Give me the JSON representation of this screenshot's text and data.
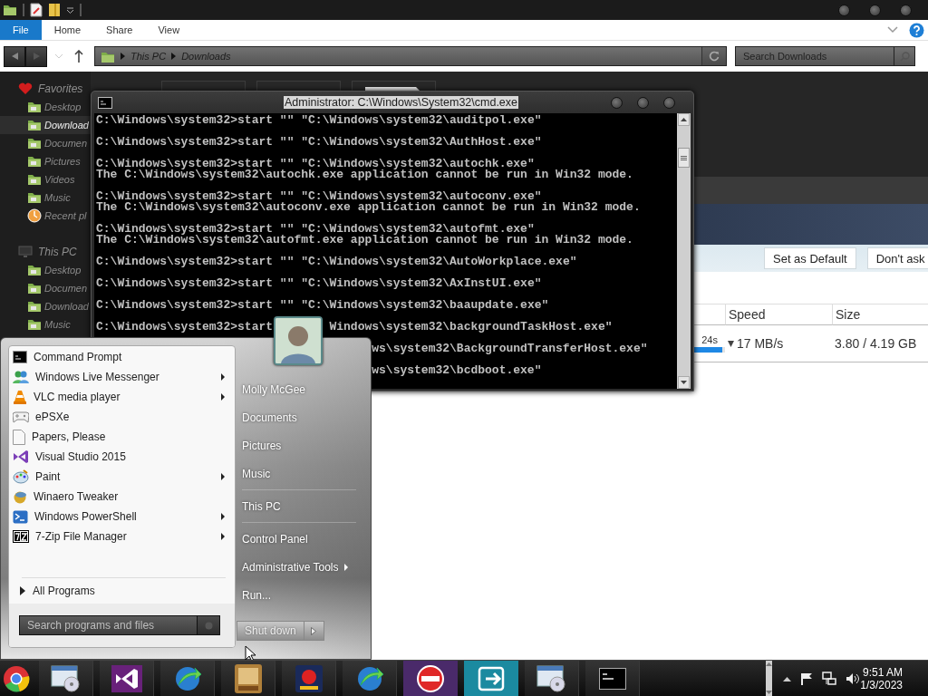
{
  "explorer": {
    "ribbon_tabs": [
      {
        "label": "File",
        "selected": true
      },
      {
        "label": "Home",
        "selected": false
      },
      {
        "label": "Share",
        "selected": false
      },
      {
        "label": "View",
        "selected": false
      }
    ],
    "breadcrumb": [
      "This PC",
      "Downloads"
    ],
    "search": {
      "placeholder": "Search Downloads"
    },
    "navigation": [
      {
        "label": "Favorites",
        "children": [
          {
            "label": "Desktop",
            "selected": false
          },
          {
            "label": "Download",
            "selected": true
          },
          {
            "label": "Documen",
            "selected": false
          },
          {
            "label": "Pictures",
            "selected": false
          },
          {
            "label": "Videos",
            "selected": false
          },
          {
            "label": "Music",
            "selected": false
          },
          {
            "label": "Recent pl",
            "selected": false
          }
        ]
      },
      {
        "label": "This PC",
        "children": [
          {
            "label": "Desktop",
            "selected": false
          },
          {
            "label": "Documen",
            "selected": false
          },
          {
            "label": "Download",
            "selected": false
          },
          {
            "label": "Music",
            "selected": false
          }
        ]
      }
    ]
  },
  "download_manager": {
    "buttons": [
      "Set as Default",
      "Don't ask"
    ],
    "columns": [
      "Speed",
      "Size"
    ],
    "rows": [
      {
        "time_left": "24s",
        "level": 0.9,
        "speed": "17 MB/s",
        "size": "3.80 / 4.19 GB"
      }
    ]
  },
  "cmd_window": {
    "title": "Administrator: C:\\Windows\\System32\\cmd.exe",
    "entries": [
      {
        "kind": "command",
        "text": "C:\\Windows\\system32>start \"\" \"C:\\Windows\\system32\\auditpol.exe\""
      },
      {
        "kind": "command",
        "text": "C:\\Windows\\system32>start \"\" \"C:\\Windows\\system32\\AuthHost.exe\""
      },
      {
        "kind": "command",
        "text": "C:\\Windows\\system32>start \"\" \"C:\\Windows\\system32\\autochk.exe\"",
        "output": "The C:\\Windows\\system32\\autochk.exe application cannot be run in Win32 mode."
      },
      {
        "kind": "command",
        "text": "C:\\Windows\\system32>start \"\" \"C:\\Windows\\system32\\autoconv.exe\"",
        "output": "The C:\\Windows\\system32\\autoconv.exe application cannot be run in Win32 mode."
      },
      {
        "kind": "command",
        "text": "C:\\Windows\\system32>start \"\" \"C:\\Windows\\system32\\autofmt.exe\"",
        "output": "The C:\\Windows\\system32\\autofmt.exe application cannot be run in Win32 mode."
      },
      {
        "kind": "command",
        "text": "C:\\Windows\\system32>start \"\" \"C:\\Windows\\system32\\AutoWorkplace.exe\""
      },
      {
        "kind": "command",
        "text": "C:\\Windows\\system32>start \"\" \"C:\\Windows\\system32\\AxInstUI.exe\""
      },
      {
        "kind": "command",
        "text": "C:\\Windows\\system32>start \"\" \"C:\\Windows\\system32\\baaupdate.exe\""
      },
      {
        "kind": "covered",
        "head": "C:\\Windows\\system32>start",
        "tail": "Windows\\system32\\backgroundTaskHost.exe\""
      },
      {
        "kind": "covered",
        "tail": "ws\\system32\\BackgroundTransferHost.exe\""
      },
      {
        "kind": "covered",
        "tail": "ws\\system32\\bcdboot.exe\""
      }
    ]
  },
  "start_menu": {
    "programs": [
      {
        "label": "Command Prompt",
        "submenu": false
      },
      {
        "label": "Windows Live Messenger",
        "submenu": true
      },
      {
        "label": "VLC media player",
        "submenu": true
      },
      {
        "label": "ePSXe",
        "submenu": false
      },
      {
        "label": "Papers, Please",
        "submenu": false
      },
      {
        "label": "Visual Studio 2015",
        "submenu": false
      },
      {
        "label": "Paint",
        "submenu": true
      },
      {
        "label": "Winaero Tweaker",
        "submenu": false
      },
      {
        "label": "Windows PowerShell",
        "submenu": true
      },
      {
        "label": "7-Zip File Manager",
        "submenu": true
      }
    ],
    "all_programs": "All Programs",
    "search": {
      "placeholder": "Search programs and files"
    },
    "place_groups": [
      {
        "items": [
          {
            "label": "Molly McGee",
            "submenu": false
          },
          {
            "label": "Documents",
            "submenu": false
          },
          {
            "label": "Pictures",
            "submenu": false
          },
          {
            "label": "Music",
            "submenu": false
          }
        ]
      },
      {
        "items": [
          {
            "label": "This PC",
            "submenu": false
          }
        ]
      },
      {
        "items": [
          {
            "label": "Control Panel",
            "submenu": false
          },
          {
            "label": "Administrative Tools",
            "submenu": true
          },
          {
            "label": "Run...",
            "submenu": false
          }
        ]
      }
    ],
    "shutdown": "Shut down"
  },
  "taskbar": {
    "time": "9:51 AM",
    "date": "1/3/2023"
  }
}
